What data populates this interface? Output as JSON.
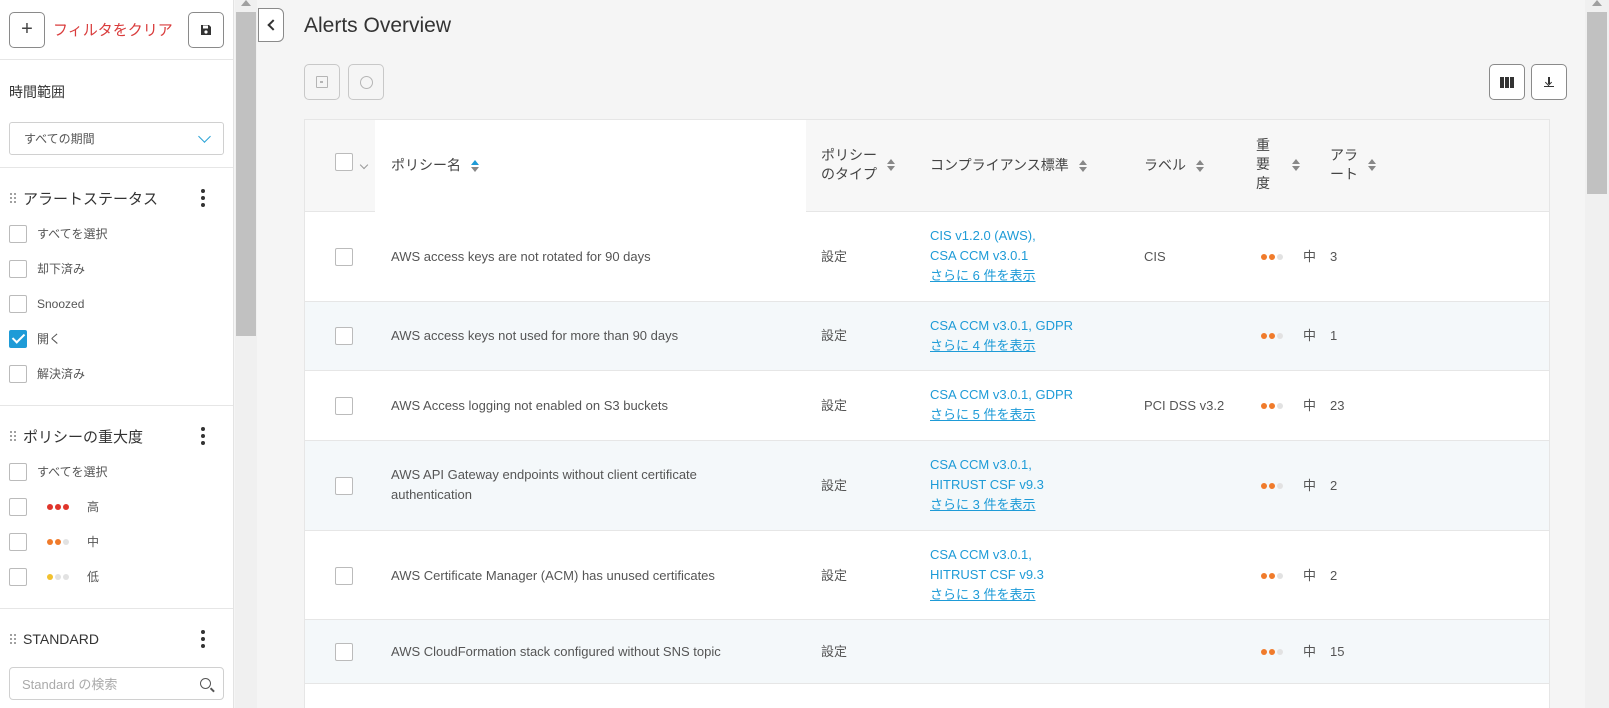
{
  "sidebar": {
    "clear_filter": "フィルタをクリア",
    "time_range": {
      "label": "時間範囲",
      "selected": "すべての期間"
    },
    "alert_status": {
      "title": "アラートステータス",
      "options": [
        {
          "label": "すべてを選択",
          "checked": false
        },
        {
          "label": "却下済み",
          "checked": false
        },
        {
          "label": "Snoozed",
          "checked": false
        },
        {
          "label": "開く",
          "checked": true
        },
        {
          "label": "解決済み",
          "checked": false
        }
      ]
    },
    "policy_severity": {
      "title": "ポリシーの重大度",
      "options": [
        {
          "label": "すべてを選択"
        },
        {
          "label": "高",
          "dots": [
            "#e0352b",
            "#e0352b",
            "#e0352b"
          ]
        },
        {
          "label": "中",
          "dots": [
            "#f07b2b",
            "#f07b2b",
            "#e2e2e2"
          ]
        },
        {
          "label": "低",
          "dots": [
            "#f2c12e",
            "#e2e2e2",
            "#e2e2e2"
          ]
        }
      ]
    },
    "standard": {
      "title": "STANDARD",
      "search_placeholder": "Standard の検索"
    }
  },
  "main": {
    "title": "Alerts Overview",
    "table": {
      "columns": {
        "policy_name": "ポリシー名",
        "policy_type_line1": "ポリシー",
        "policy_type_line2": "のタイプ",
        "compliance": "コンプライアンス標準",
        "label": "ラベル",
        "severity_l1": "重",
        "severity_l2": "要",
        "severity_l3": "度",
        "alerts_l1": "アラ",
        "alerts_l2": "ート"
      },
      "rows": [
        {
          "name": "AWS access keys are not rotated for 90 days",
          "name2": "",
          "type": "設定",
          "std1": "CIS v1.2.0 (AWS),",
          "std2": "CSA CCM v3.0.1",
          "more": "さらに 6 件を表示",
          "label": "CIS",
          "severity": "中",
          "alerts": "3"
        },
        {
          "name": "AWS access keys not used for more than 90 days",
          "name2": "",
          "type": "設定",
          "std1": "CSA CCM v3.0.1, GDPR",
          "std2": "",
          "more": "さらに 4 件を表示",
          "label": "",
          "severity": "中",
          "alerts": "1"
        },
        {
          "name": "AWS Access logging not enabled on S3 buckets",
          "name2": "",
          "type": "設定",
          "std1": "CSA CCM v3.0.1, GDPR",
          "std2": "",
          "more": "さらに 5 件を表示",
          "label": "PCI DSS v3.2",
          "severity": "中",
          "alerts": "23"
        },
        {
          "name": "AWS API Gateway endpoints without client certificate",
          "name2": "authentication",
          "type": "設定",
          "std1": "CSA CCM v3.0.1,",
          "std2": "HITRUST CSF v9.3",
          "more": "さらに 3 件を表示",
          "label": "",
          "severity": "中",
          "alerts": "2"
        },
        {
          "name": "AWS Certificate Manager (ACM) has unused certificates",
          "name2": "",
          "type": "設定",
          "std1": "CSA CCM v3.0.1,",
          "std2": "HITRUST CSF v9.3",
          "more": "さらに 3 件を表示",
          "label": "",
          "severity": "中",
          "alerts": "2"
        },
        {
          "name": "AWS CloudFormation stack configured without SNS topic",
          "name2": "",
          "type": "設定",
          "std1": "",
          "std2": "",
          "more": "",
          "label": "",
          "severity": "中",
          "alerts": "15"
        }
      ]
    }
  },
  "colors": {
    "accent": "#1e9bd7",
    "danger": "#d93c3c",
    "medium": "#f07b2b"
  }
}
